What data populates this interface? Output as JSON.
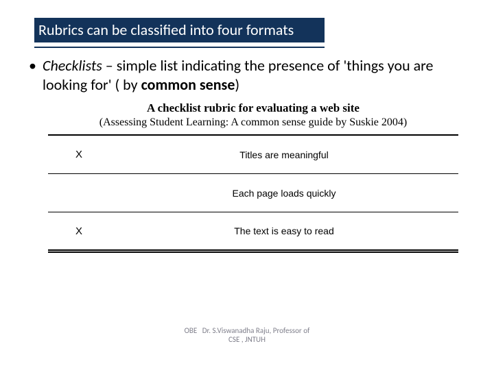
{
  "title": "Rubrics can be classified into four formats",
  "bullet": {
    "term": "Checklists",
    "dash": " – ",
    "rest1": "simple list indicating the presence of 'things you are looking for' ( by ",
    "bold_phrase": "common sense",
    "rest2": ")"
  },
  "table": {
    "heading": "A checklist rubric for evaluating a web site",
    "subheading": "(Assessing Student Learning: A common sense guide by Suskie 2004)",
    "rows": [
      {
        "mark": "X",
        "desc": "Titles are meaningful"
      },
      {
        "mark": "",
        "desc": "Each page loads quickly"
      },
      {
        "mark": "X",
        "desc": "The text is easy to read"
      }
    ]
  },
  "footer": {
    "left": "OBE",
    "right_line1": "Dr. S.Viswanadha Raju, Professor of",
    "right_line2": "CSE , JNTUH"
  }
}
